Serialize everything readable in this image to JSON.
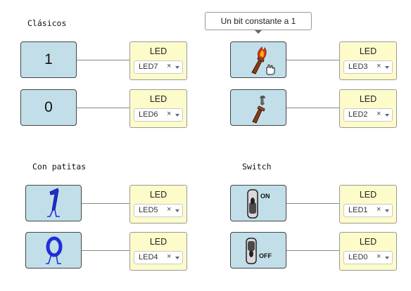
{
  "sections": {
    "clasicos": "Clásicos",
    "con_patitas": "Con patitas",
    "switch": "Switch"
  },
  "tooltip": "Un bit constante a 1",
  "blocks": {
    "b1": {
      "value": "1"
    },
    "b0": {
      "value": "0"
    }
  },
  "icon_names": {
    "torch_on": "lit-torch-icon",
    "torch_off": "smoking-torch-icon",
    "legs_one": "one-with-legs-icon",
    "legs_zero": "zero-with-legs-icon",
    "switch_on": "toggle-switch-on-icon",
    "switch_off": "toggle-switch-off-icon",
    "cursor": "hand-cursor-icon"
  },
  "switch_labels": {
    "on": "ON",
    "off": "OFF"
  },
  "led_title": "LED",
  "leds": {
    "led7": "LED7",
    "led6": "LED6",
    "led5": "LED5",
    "led4": "LED4",
    "led3": "LED3",
    "led2": "LED2",
    "led1": "LED1",
    "led0": "LED0"
  },
  "clear_glyph": "×",
  "colors": {
    "block_blue": "#c2dfe9",
    "led_yellow": "#fdfbc9",
    "wire": "#888888",
    "legs_blue": "#1f2fd6"
  }
}
